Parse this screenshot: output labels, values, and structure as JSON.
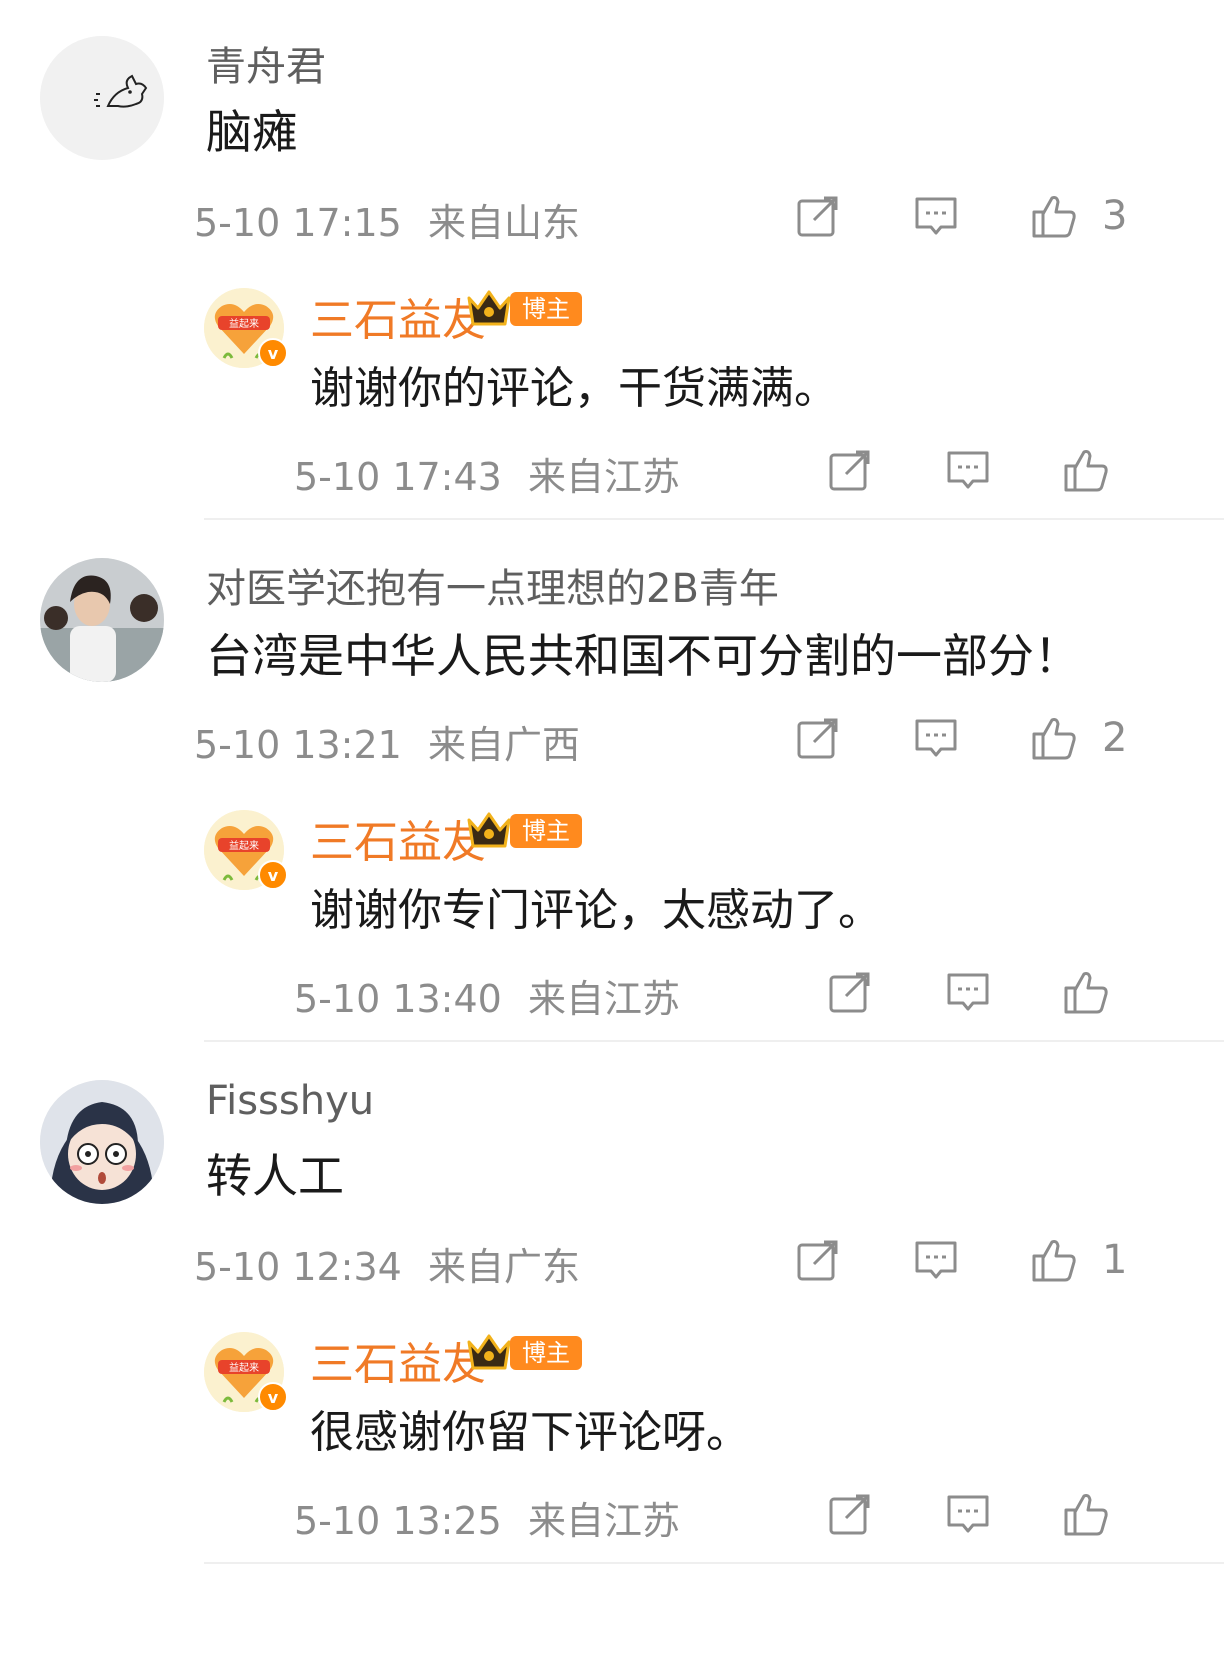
{
  "comments": [
    {
      "user": "青舟君",
      "text": "脑瘫",
      "time": "5-10 17:15",
      "location": "来自山东",
      "likes": "3",
      "reply": {
        "user": "三石益友",
        "badge": "博主",
        "avatar_text": "益起来",
        "verified": "v",
        "text": "谢谢你的评论，干货满满。",
        "time": "5-10 17:43",
        "location": "来自江苏"
      }
    },
    {
      "user": "对医学还抱有一点理想的2B青年",
      "text": "台湾是中华人民共和国不可分割的一部分！",
      "time": "5-10 13:21",
      "location": "来自广西",
      "likes": "2",
      "reply": {
        "user": "三石益友",
        "badge": "博主",
        "avatar_text": "益起来",
        "verified": "v",
        "text": "谢谢你专门评论，太感动了。",
        "time": "5-10 13:40",
        "location": "来自江苏"
      }
    },
    {
      "user": "Fissshyu",
      "text": "转人工",
      "time": "5-10 12:34",
      "location": "来自广东",
      "likes": "1",
      "reply": {
        "user": "三石益友",
        "badge": "博主",
        "avatar_text": "益起来",
        "verified": "v",
        "text": "很感谢你留下评论呀。",
        "time": "5-10 13:25",
        "location": "来自江苏"
      }
    }
  ],
  "icons": {
    "repost": "repost-icon",
    "comment": "comment-icon",
    "like": "like-icon",
    "crown": "crown-icon"
  },
  "colors": {
    "author_name": "#f07a26",
    "badge": "#ff8a1e",
    "meta": "#8c8c8c"
  }
}
